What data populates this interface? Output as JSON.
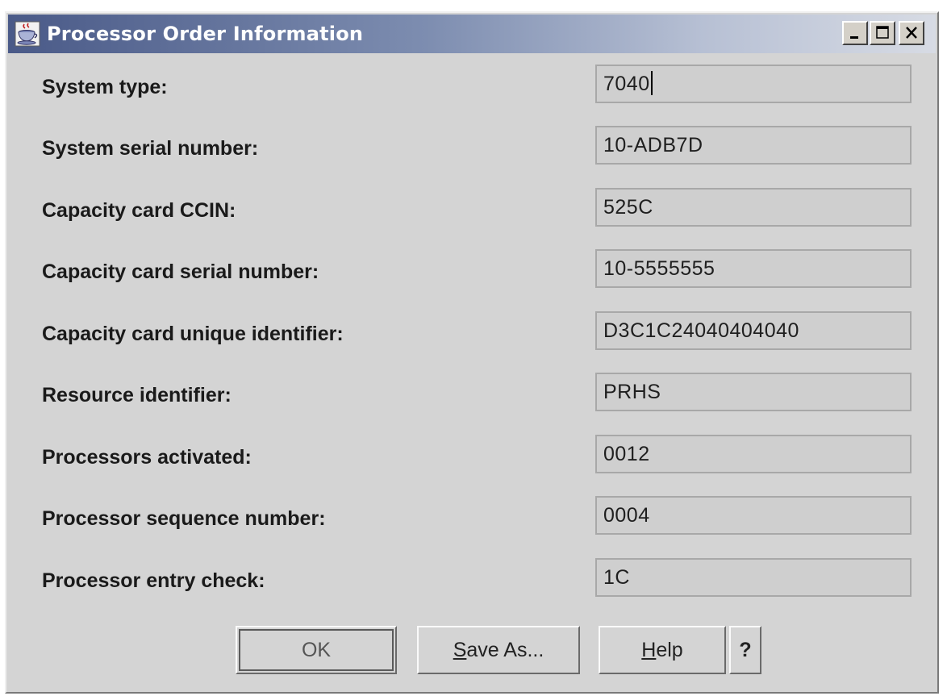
{
  "window": {
    "title": "Processor Order Information"
  },
  "fields": [
    {
      "label": "System type:",
      "value": "7040"
    },
    {
      "label": "System serial number:",
      "value": "10-ADB7D"
    },
    {
      "label": "Capacity card CCIN:",
      "value": "525C"
    },
    {
      "label": "Capacity card serial number:",
      "value": "10-5555555"
    },
    {
      "label": "Capacity card unique identifier:",
      "value": "D3C1C24040404040"
    },
    {
      "label": "Resource identifier:",
      "value": "PRHS"
    },
    {
      "label": "Processors activated:",
      "value": "0012"
    },
    {
      "label": "Processor sequence number:",
      "value": "0004"
    },
    {
      "label": "Processor entry check:",
      "value": "1C"
    }
  ],
  "buttons": {
    "ok": "OK",
    "save_as_mnemonic": "S",
    "save_as_rest": "ave As...",
    "help_mnemonic": "H",
    "help_rest": "elp",
    "context_help": "?"
  },
  "icons": {
    "app": "java-coffee-cup-icon",
    "minimize": "minimize-icon",
    "maximize": "maximize-icon",
    "close": "close-icon"
  },
  "colors": {
    "title_gradient_start": "#4a5a88",
    "title_gradient_end": "#d7dbe4",
    "window_bg": "#d4d4d4",
    "field_bg": "#cfcfcf"
  }
}
